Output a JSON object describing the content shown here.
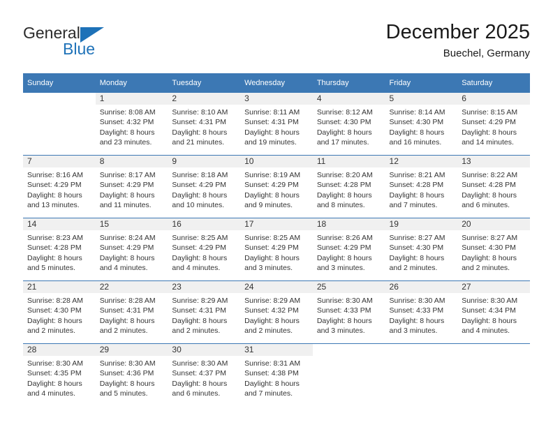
{
  "brand": {
    "name_part1": "General",
    "name_part2": "Blue",
    "triangle_icon": "triangle-icon",
    "accent_color": "#1e72b8"
  },
  "header": {
    "title": "December 2025",
    "subtitle": "Buechel, Germany"
  },
  "calendar": {
    "header_bg": "#3c78b4",
    "daynum_bg": "#f0f0f0",
    "weekdays": [
      "Sunday",
      "Monday",
      "Tuesday",
      "Wednesday",
      "Thursday",
      "Friday",
      "Saturday"
    ],
    "weeks": [
      [
        {
          "day": "",
          "sunrise": "",
          "sunset": "",
          "daylight1": "",
          "daylight2": ""
        },
        {
          "day": "1",
          "sunrise": "Sunrise: 8:08 AM",
          "sunset": "Sunset: 4:32 PM",
          "daylight1": "Daylight: 8 hours",
          "daylight2": "and 23 minutes."
        },
        {
          "day": "2",
          "sunrise": "Sunrise: 8:10 AM",
          "sunset": "Sunset: 4:31 PM",
          "daylight1": "Daylight: 8 hours",
          "daylight2": "and 21 minutes."
        },
        {
          "day": "3",
          "sunrise": "Sunrise: 8:11 AM",
          "sunset": "Sunset: 4:31 PM",
          "daylight1": "Daylight: 8 hours",
          "daylight2": "and 19 minutes."
        },
        {
          "day": "4",
          "sunrise": "Sunrise: 8:12 AM",
          "sunset": "Sunset: 4:30 PM",
          "daylight1": "Daylight: 8 hours",
          "daylight2": "and 17 minutes."
        },
        {
          "day": "5",
          "sunrise": "Sunrise: 8:14 AM",
          "sunset": "Sunset: 4:30 PM",
          "daylight1": "Daylight: 8 hours",
          "daylight2": "and 16 minutes."
        },
        {
          "day": "6",
          "sunrise": "Sunrise: 8:15 AM",
          "sunset": "Sunset: 4:29 PM",
          "daylight1": "Daylight: 8 hours",
          "daylight2": "and 14 minutes."
        }
      ],
      [
        {
          "day": "7",
          "sunrise": "Sunrise: 8:16 AM",
          "sunset": "Sunset: 4:29 PM",
          "daylight1": "Daylight: 8 hours",
          "daylight2": "and 13 minutes."
        },
        {
          "day": "8",
          "sunrise": "Sunrise: 8:17 AM",
          "sunset": "Sunset: 4:29 PM",
          "daylight1": "Daylight: 8 hours",
          "daylight2": "and 11 minutes."
        },
        {
          "day": "9",
          "sunrise": "Sunrise: 8:18 AM",
          "sunset": "Sunset: 4:29 PM",
          "daylight1": "Daylight: 8 hours",
          "daylight2": "and 10 minutes."
        },
        {
          "day": "10",
          "sunrise": "Sunrise: 8:19 AM",
          "sunset": "Sunset: 4:29 PM",
          "daylight1": "Daylight: 8 hours",
          "daylight2": "and 9 minutes."
        },
        {
          "day": "11",
          "sunrise": "Sunrise: 8:20 AM",
          "sunset": "Sunset: 4:28 PM",
          "daylight1": "Daylight: 8 hours",
          "daylight2": "and 8 minutes."
        },
        {
          "day": "12",
          "sunrise": "Sunrise: 8:21 AM",
          "sunset": "Sunset: 4:28 PM",
          "daylight1": "Daylight: 8 hours",
          "daylight2": "and 7 minutes."
        },
        {
          "day": "13",
          "sunrise": "Sunrise: 8:22 AM",
          "sunset": "Sunset: 4:28 PM",
          "daylight1": "Daylight: 8 hours",
          "daylight2": "and 6 minutes."
        }
      ],
      [
        {
          "day": "14",
          "sunrise": "Sunrise: 8:23 AM",
          "sunset": "Sunset: 4:28 PM",
          "daylight1": "Daylight: 8 hours",
          "daylight2": "and 5 minutes."
        },
        {
          "day": "15",
          "sunrise": "Sunrise: 8:24 AM",
          "sunset": "Sunset: 4:29 PM",
          "daylight1": "Daylight: 8 hours",
          "daylight2": "and 4 minutes."
        },
        {
          "day": "16",
          "sunrise": "Sunrise: 8:25 AM",
          "sunset": "Sunset: 4:29 PM",
          "daylight1": "Daylight: 8 hours",
          "daylight2": "and 4 minutes."
        },
        {
          "day": "17",
          "sunrise": "Sunrise: 8:25 AM",
          "sunset": "Sunset: 4:29 PM",
          "daylight1": "Daylight: 8 hours",
          "daylight2": "and 3 minutes."
        },
        {
          "day": "18",
          "sunrise": "Sunrise: 8:26 AM",
          "sunset": "Sunset: 4:29 PM",
          "daylight1": "Daylight: 8 hours",
          "daylight2": "and 3 minutes."
        },
        {
          "day": "19",
          "sunrise": "Sunrise: 8:27 AM",
          "sunset": "Sunset: 4:30 PM",
          "daylight1": "Daylight: 8 hours",
          "daylight2": "and 2 minutes."
        },
        {
          "day": "20",
          "sunrise": "Sunrise: 8:27 AM",
          "sunset": "Sunset: 4:30 PM",
          "daylight1": "Daylight: 8 hours",
          "daylight2": "and 2 minutes."
        }
      ],
      [
        {
          "day": "21",
          "sunrise": "Sunrise: 8:28 AM",
          "sunset": "Sunset: 4:30 PM",
          "daylight1": "Daylight: 8 hours",
          "daylight2": "and 2 minutes."
        },
        {
          "day": "22",
          "sunrise": "Sunrise: 8:28 AM",
          "sunset": "Sunset: 4:31 PM",
          "daylight1": "Daylight: 8 hours",
          "daylight2": "and 2 minutes."
        },
        {
          "day": "23",
          "sunrise": "Sunrise: 8:29 AM",
          "sunset": "Sunset: 4:31 PM",
          "daylight1": "Daylight: 8 hours",
          "daylight2": "and 2 minutes."
        },
        {
          "day": "24",
          "sunrise": "Sunrise: 8:29 AM",
          "sunset": "Sunset: 4:32 PM",
          "daylight1": "Daylight: 8 hours",
          "daylight2": "and 2 minutes."
        },
        {
          "day": "25",
          "sunrise": "Sunrise: 8:30 AM",
          "sunset": "Sunset: 4:33 PM",
          "daylight1": "Daylight: 8 hours",
          "daylight2": "and 3 minutes."
        },
        {
          "day": "26",
          "sunrise": "Sunrise: 8:30 AM",
          "sunset": "Sunset: 4:33 PM",
          "daylight1": "Daylight: 8 hours",
          "daylight2": "and 3 minutes."
        },
        {
          "day": "27",
          "sunrise": "Sunrise: 8:30 AM",
          "sunset": "Sunset: 4:34 PM",
          "daylight1": "Daylight: 8 hours",
          "daylight2": "and 4 minutes."
        }
      ],
      [
        {
          "day": "28",
          "sunrise": "Sunrise: 8:30 AM",
          "sunset": "Sunset: 4:35 PM",
          "daylight1": "Daylight: 8 hours",
          "daylight2": "and 4 minutes."
        },
        {
          "day": "29",
          "sunrise": "Sunrise: 8:30 AM",
          "sunset": "Sunset: 4:36 PM",
          "daylight1": "Daylight: 8 hours",
          "daylight2": "and 5 minutes."
        },
        {
          "day": "30",
          "sunrise": "Sunrise: 8:30 AM",
          "sunset": "Sunset: 4:37 PM",
          "daylight1": "Daylight: 8 hours",
          "daylight2": "and 6 minutes."
        },
        {
          "day": "31",
          "sunrise": "Sunrise: 8:31 AM",
          "sunset": "Sunset: 4:38 PM",
          "daylight1": "Daylight: 8 hours",
          "daylight2": "and 7 minutes."
        },
        {
          "day": "",
          "sunrise": "",
          "sunset": "",
          "daylight1": "",
          "daylight2": ""
        },
        {
          "day": "",
          "sunrise": "",
          "sunset": "",
          "daylight1": "",
          "daylight2": ""
        },
        {
          "day": "",
          "sunrise": "",
          "sunset": "",
          "daylight1": "",
          "daylight2": ""
        }
      ]
    ]
  }
}
